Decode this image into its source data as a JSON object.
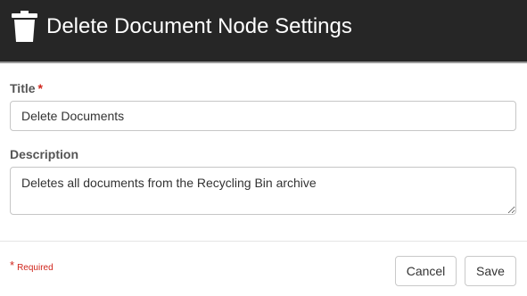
{
  "header": {
    "title": "Delete Document Node Settings",
    "icon": "trash-icon"
  },
  "form": {
    "title_label": "Title",
    "required_mark": "*",
    "title_value": "Delete Documents",
    "description_label": "Description",
    "description_value": "Deletes all documents from the Recycling Bin archive"
  },
  "footer": {
    "required_mark": "*",
    "required_text": "Required",
    "cancel_label": "Cancel",
    "save_label": "Save"
  },
  "colors": {
    "header_background": "#262626",
    "required_red": "#d0261d"
  }
}
